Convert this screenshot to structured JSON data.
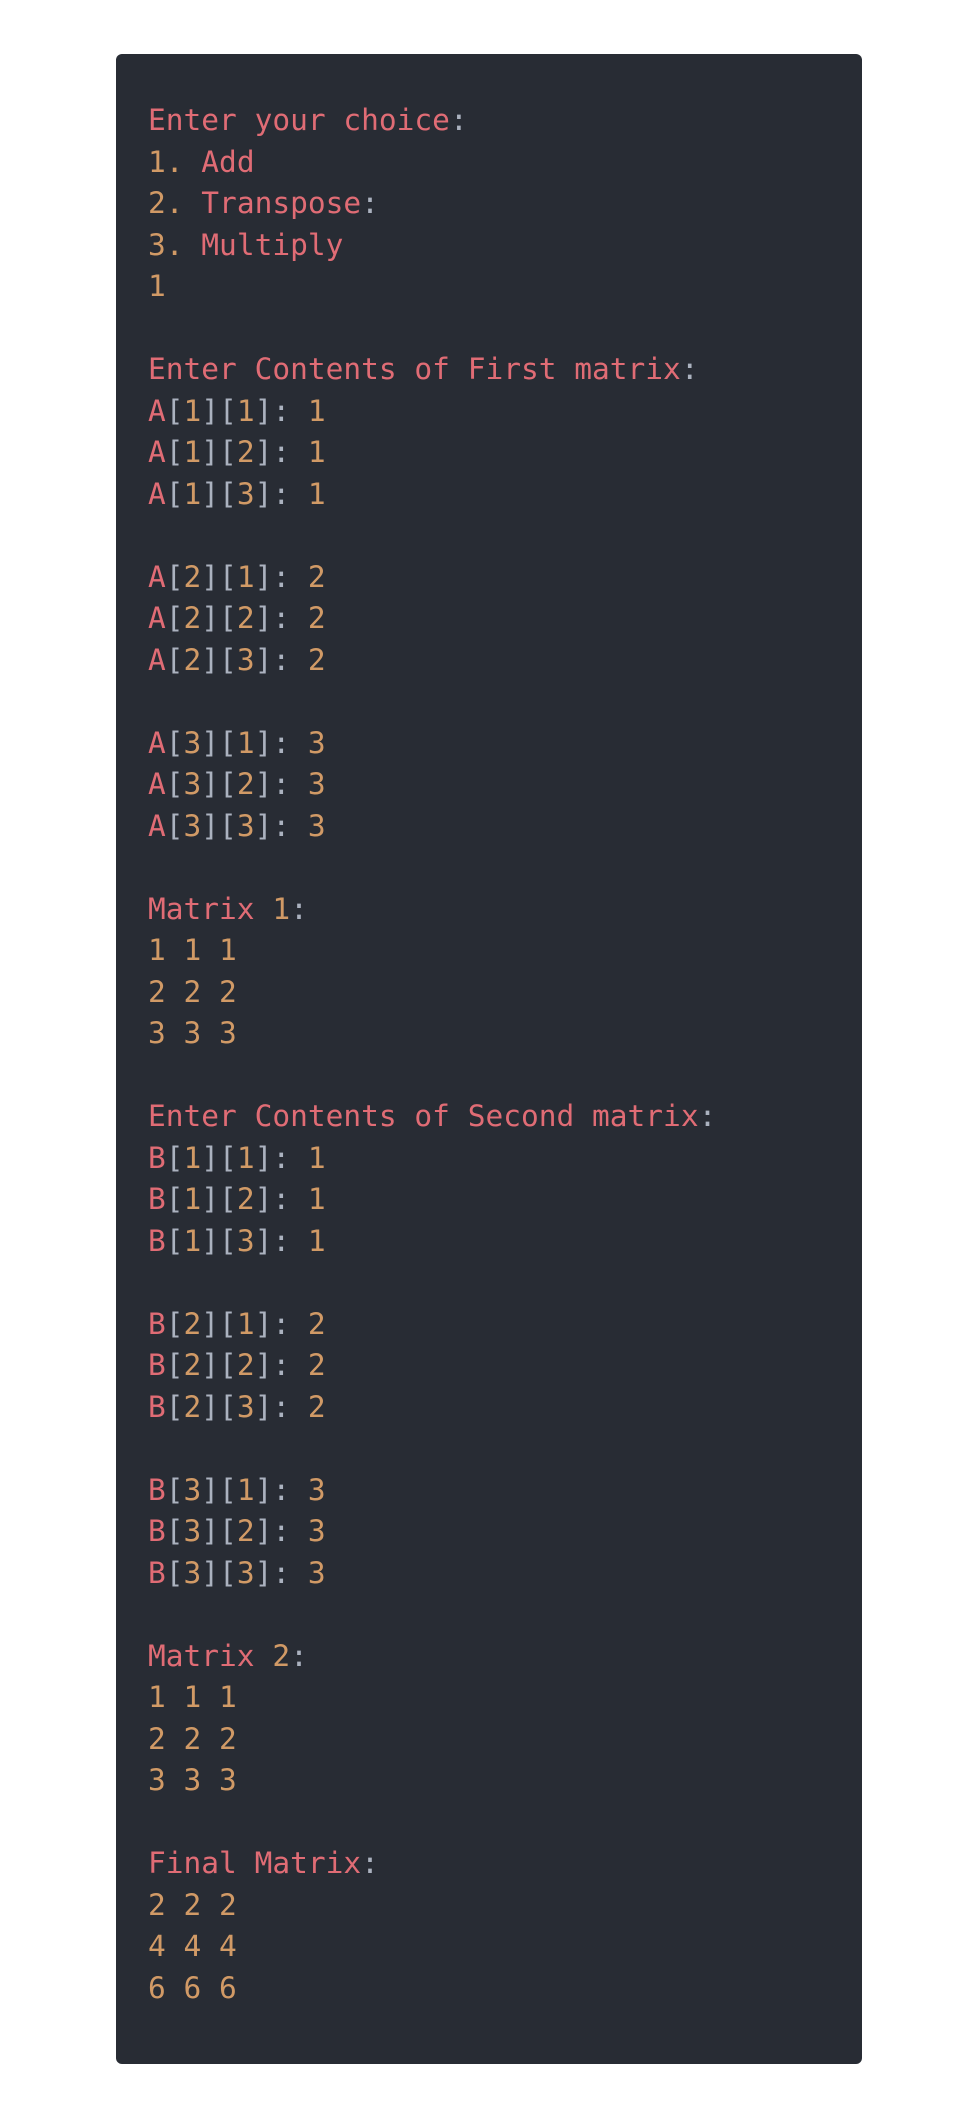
{
  "colors": {
    "background": "#282c34",
    "keyword": "#e06c75",
    "number": "#d19a66",
    "punctuation": "#abb2bf"
  },
  "lines": [
    [
      [
        "k",
        "Enter your choice"
      ],
      [
        "p",
        ":"
      ]
    ],
    [
      [
        "n",
        "1."
      ],
      [
        "k",
        " Add"
      ]
    ],
    [
      [
        "n",
        "2."
      ],
      [
        "k",
        " Transpose"
      ],
      [
        "p",
        ":"
      ]
    ],
    [
      [
        "n",
        "3."
      ],
      [
        "k",
        " Multiply"
      ]
    ],
    [
      [
        "n",
        "1"
      ]
    ],
    [],
    [
      [
        "k",
        "Enter Contents of First matrix"
      ],
      [
        "p",
        ":"
      ]
    ],
    [
      [
        "k",
        "A"
      ],
      [
        "p",
        "["
      ],
      [
        "n",
        "1"
      ],
      [
        "p",
        "]["
      ],
      [
        "n",
        "1"
      ],
      [
        "p",
        "]: "
      ],
      [
        "n",
        "1"
      ]
    ],
    [
      [
        "k",
        "A"
      ],
      [
        "p",
        "["
      ],
      [
        "n",
        "1"
      ],
      [
        "p",
        "]["
      ],
      [
        "n",
        "2"
      ],
      [
        "p",
        "]: "
      ],
      [
        "n",
        "1"
      ]
    ],
    [
      [
        "k",
        "A"
      ],
      [
        "p",
        "["
      ],
      [
        "n",
        "1"
      ],
      [
        "p",
        "]["
      ],
      [
        "n",
        "3"
      ],
      [
        "p",
        "]: "
      ],
      [
        "n",
        "1"
      ]
    ],
    [],
    [
      [
        "k",
        "A"
      ],
      [
        "p",
        "["
      ],
      [
        "n",
        "2"
      ],
      [
        "p",
        "]["
      ],
      [
        "n",
        "1"
      ],
      [
        "p",
        "]: "
      ],
      [
        "n",
        "2"
      ]
    ],
    [
      [
        "k",
        "A"
      ],
      [
        "p",
        "["
      ],
      [
        "n",
        "2"
      ],
      [
        "p",
        "]["
      ],
      [
        "n",
        "2"
      ],
      [
        "p",
        "]: "
      ],
      [
        "n",
        "2"
      ]
    ],
    [
      [
        "k",
        "A"
      ],
      [
        "p",
        "["
      ],
      [
        "n",
        "2"
      ],
      [
        "p",
        "]["
      ],
      [
        "n",
        "3"
      ],
      [
        "p",
        "]: "
      ],
      [
        "n",
        "2"
      ]
    ],
    [],
    [
      [
        "k",
        "A"
      ],
      [
        "p",
        "["
      ],
      [
        "n",
        "3"
      ],
      [
        "p",
        "]["
      ],
      [
        "n",
        "1"
      ],
      [
        "p",
        "]: "
      ],
      [
        "n",
        "3"
      ]
    ],
    [
      [
        "k",
        "A"
      ],
      [
        "p",
        "["
      ],
      [
        "n",
        "3"
      ],
      [
        "p",
        "]["
      ],
      [
        "n",
        "2"
      ],
      [
        "p",
        "]: "
      ],
      [
        "n",
        "3"
      ]
    ],
    [
      [
        "k",
        "A"
      ],
      [
        "p",
        "["
      ],
      [
        "n",
        "3"
      ],
      [
        "p",
        "]["
      ],
      [
        "n",
        "3"
      ],
      [
        "p",
        "]: "
      ],
      [
        "n",
        "3"
      ]
    ],
    [],
    [
      [
        "k",
        "Matrix "
      ],
      [
        "n",
        "1"
      ],
      [
        "p",
        ":"
      ]
    ],
    [
      [
        "n",
        "1 1 1"
      ]
    ],
    [
      [
        "n",
        "2 2 2"
      ]
    ],
    [
      [
        "n",
        "3 3 3"
      ]
    ],
    [],
    [
      [
        "k",
        "Enter Contents of Second matrix"
      ],
      [
        "p",
        ":"
      ]
    ],
    [
      [
        "k",
        "B"
      ],
      [
        "p",
        "["
      ],
      [
        "n",
        "1"
      ],
      [
        "p",
        "]["
      ],
      [
        "n",
        "1"
      ],
      [
        "p",
        "]: "
      ],
      [
        "n",
        "1"
      ]
    ],
    [
      [
        "k",
        "B"
      ],
      [
        "p",
        "["
      ],
      [
        "n",
        "1"
      ],
      [
        "p",
        "]["
      ],
      [
        "n",
        "2"
      ],
      [
        "p",
        "]: "
      ],
      [
        "n",
        "1"
      ]
    ],
    [
      [
        "k",
        "B"
      ],
      [
        "p",
        "["
      ],
      [
        "n",
        "1"
      ],
      [
        "p",
        "]["
      ],
      [
        "n",
        "3"
      ],
      [
        "p",
        "]: "
      ],
      [
        "n",
        "1"
      ]
    ],
    [],
    [
      [
        "k",
        "B"
      ],
      [
        "p",
        "["
      ],
      [
        "n",
        "2"
      ],
      [
        "p",
        "]["
      ],
      [
        "n",
        "1"
      ],
      [
        "p",
        "]: "
      ],
      [
        "n",
        "2"
      ]
    ],
    [
      [
        "k",
        "B"
      ],
      [
        "p",
        "["
      ],
      [
        "n",
        "2"
      ],
      [
        "p",
        "]["
      ],
      [
        "n",
        "2"
      ],
      [
        "p",
        "]: "
      ],
      [
        "n",
        "2"
      ]
    ],
    [
      [
        "k",
        "B"
      ],
      [
        "p",
        "["
      ],
      [
        "n",
        "2"
      ],
      [
        "p",
        "]["
      ],
      [
        "n",
        "3"
      ],
      [
        "p",
        "]: "
      ],
      [
        "n",
        "2"
      ]
    ],
    [],
    [
      [
        "k",
        "B"
      ],
      [
        "p",
        "["
      ],
      [
        "n",
        "3"
      ],
      [
        "p",
        "]["
      ],
      [
        "n",
        "1"
      ],
      [
        "p",
        "]: "
      ],
      [
        "n",
        "3"
      ]
    ],
    [
      [
        "k",
        "B"
      ],
      [
        "p",
        "["
      ],
      [
        "n",
        "3"
      ],
      [
        "p",
        "]["
      ],
      [
        "n",
        "2"
      ],
      [
        "p",
        "]: "
      ],
      [
        "n",
        "3"
      ]
    ],
    [
      [
        "k",
        "B"
      ],
      [
        "p",
        "["
      ],
      [
        "n",
        "3"
      ],
      [
        "p",
        "]["
      ],
      [
        "n",
        "3"
      ],
      [
        "p",
        "]: "
      ],
      [
        "n",
        "3"
      ]
    ],
    [],
    [
      [
        "k",
        "Matrix "
      ],
      [
        "n",
        "2"
      ],
      [
        "p",
        ":"
      ]
    ],
    [
      [
        "n",
        "1 1 1"
      ]
    ],
    [
      [
        "n",
        "2 2 2"
      ]
    ],
    [
      [
        "n",
        "3 3 3"
      ]
    ],
    [],
    [
      [
        "k",
        "Final Matrix"
      ],
      [
        "p",
        ":"
      ]
    ],
    [
      [
        "n",
        "2 2 2"
      ]
    ],
    [
      [
        "n",
        "4 4 4"
      ]
    ],
    [
      [
        "n",
        "6 6 6"
      ]
    ]
  ]
}
